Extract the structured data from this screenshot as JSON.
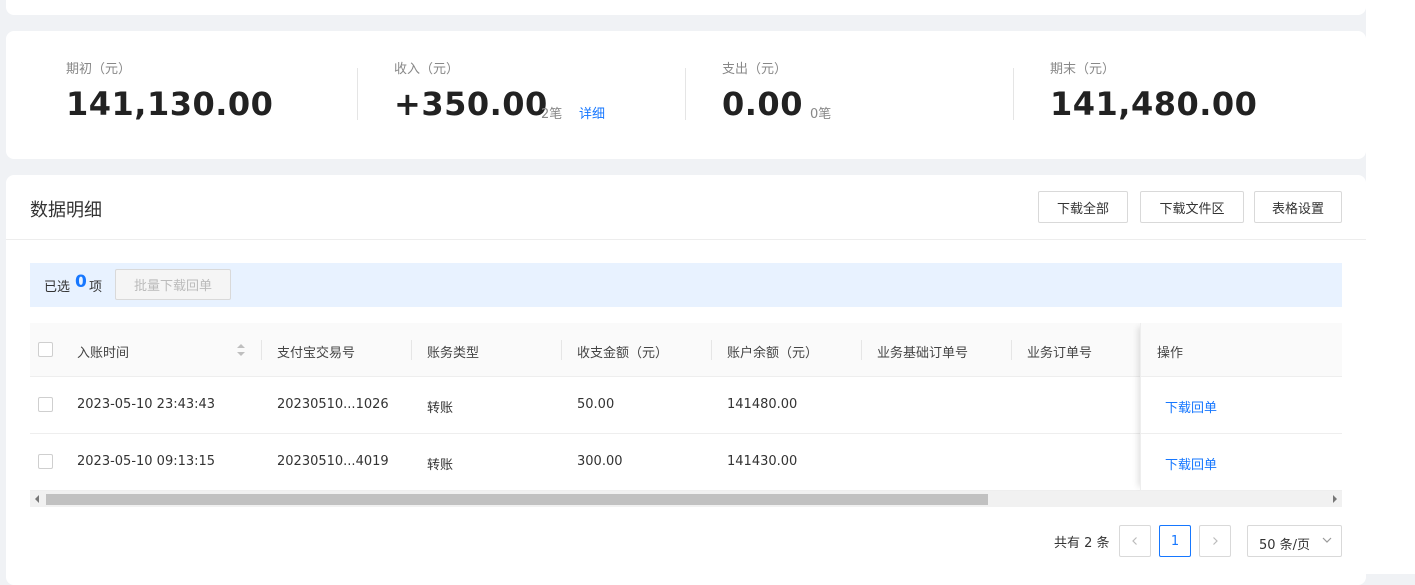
{
  "summary": [
    {
      "label": "期初（元）",
      "value": "141,130.00"
    },
    {
      "label": "收入（元）",
      "value": "+350.00",
      "count": "2笔",
      "link": "详细"
    },
    {
      "label": "支出（元）",
      "value": "0.00",
      "count": "0笔"
    },
    {
      "label": "期末（元）",
      "value": "141,480.00"
    }
  ],
  "section": {
    "title": "数据明细",
    "buttons": [
      "下载全部",
      "下载文件区",
      "表格设置"
    ]
  },
  "selection": {
    "prefix": "已选",
    "count": "0",
    "unit": "项",
    "batch_button": "批量下载回单"
  },
  "table": {
    "headers": [
      "入账时间",
      "支付宝交易号",
      "账务类型",
      "收支金额（元）",
      "账户余额（元）",
      "业务基础订单号",
      "业务订单号",
      "操作"
    ],
    "rows": [
      {
        "time": "2023-05-10 23:43:43",
        "trade_no": "20230510...1026",
        "type": "转账",
        "amount": "50.00",
        "balance": "141480.00",
        "action": "下载回单"
      },
      {
        "time": "2023-05-10 09:13:15",
        "trade_no": "20230510...4019",
        "type": "转账",
        "amount": "300.00",
        "balance": "141430.00",
        "action": "下载回单"
      }
    ]
  },
  "pagination": {
    "total": "共有 2 条",
    "current_page": "1",
    "page_size": "50 条/页"
  }
}
